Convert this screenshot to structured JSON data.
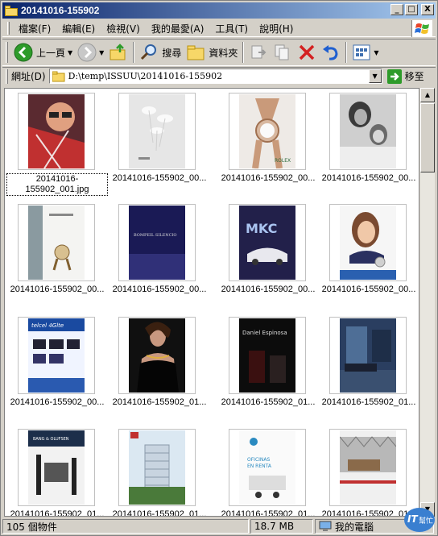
{
  "window": {
    "title": "20141016-155902",
    "btn_min": "_",
    "btn_max": "□",
    "btn_close": "X"
  },
  "menu": [
    "檔案(F)",
    "編輯(E)",
    "檢視(V)",
    "我的最愛(A)",
    "工具(T)",
    "說明(H)"
  ],
  "toolbar": {
    "back_label": "上一頁",
    "search_label": "搜尋",
    "folders_label": "資料夾"
  },
  "address": {
    "label": "網址(D)",
    "path": "D:\\temp\\ISSUU\\20141016-155902",
    "go_label": "移至"
  },
  "thumbnails": [
    {
      "label": "20141016-155902_001.jpg",
      "art": "sunglasses-woman"
    },
    {
      "label": "20141016-155902_00...",
      "art": "white-flowers"
    },
    {
      "label": "20141016-155902_00...",
      "art": "rolex-watch"
    },
    {
      "label": "20141016-155902_00...",
      "art": "bw-mother-daughter"
    },
    {
      "label": "20141016-155902_00...",
      "art": "watch-ad-pale"
    },
    {
      "label": "20141016-155902_00...",
      "art": "bompeil-silencio"
    },
    {
      "label": "20141016-155902_00...",
      "art": "mkc-car"
    },
    {
      "label": "20141016-155902_00...",
      "art": "smiling-woman-ad"
    },
    {
      "label": "20141016-155902_00...",
      "art": "telcel-4g"
    },
    {
      "label": "20141016-155902_01...",
      "art": "woman-black-dress"
    },
    {
      "label": "20141016-155902_01...",
      "art": "daniel-espinosa"
    },
    {
      "label": "20141016-155902_01...",
      "art": "blue-living-room"
    },
    {
      "label": "20141016-155902_01...",
      "art": "bang-olufsen"
    },
    {
      "label": "20141016-155902_01...",
      "art": "tower-building"
    },
    {
      "label": "20141016-155902_01...",
      "art": "offices-ad"
    },
    {
      "label": "20141016-155902_01...",
      "art": "loft-interior"
    }
  ],
  "art_text": {
    "bompeil": "BOMPEIL SILENCIO",
    "mkc": "MKC",
    "telcel": "telcel 4Glte",
    "daniel": "Daniel Espinosa",
    "bang": "BANG & OLUFSEN",
    "offices": "OFICINAS\nEN RENTA",
    "rolex": "ROLEX"
  },
  "status": {
    "count": "105 個物件",
    "size": "18.7 MB",
    "zone": "我的電腦"
  },
  "badge": {
    "brand": "IT",
    "sub": "幫忙"
  },
  "colors": {
    "titlebar_start": "#0a246a",
    "titlebar_end": "#a6caf0",
    "face": "#d4d0c8",
    "back_green": "#2e9b2a",
    "delete_red": "#d42020",
    "badge_blue": "#3a7fd0"
  }
}
